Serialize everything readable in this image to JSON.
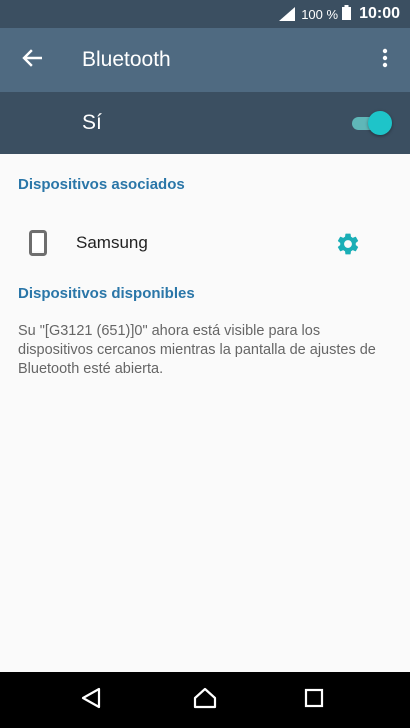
{
  "status_bar": {
    "battery_percent": "100 %",
    "time": "10:00",
    "icons": [
      "signal-icon",
      "battery-icon"
    ]
  },
  "app_bar": {
    "title": "Bluetooth",
    "back_icon": "arrow-back-icon",
    "menu_icon": "more-vert-icon"
  },
  "master_switch": {
    "label": "Sí",
    "state": true
  },
  "sections": {
    "paired_title": "Dispositivos asociados",
    "available_title": "Dispositivos disponibles"
  },
  "paired_devices": [
    {
      "name": "Samsung",
      "icon": "phone-icon",
      "action_icon": "gear-icon"
    }
  ],
  "info_text": "Su \"[G3121 (651)]0\" ahora está visible para los dispositivos cercanos mientras la pantalla de ajustes de Bluetooth esté abierta.",
  "nav_bar": {
    "icons": [
      "back-triangle-icon",
      "home-icon",
      "recents-icon"
    ]
  },
  "colors": {
    "status_bar_bg": "#3b4f61",
    "app_bar_bg": "#4f6a81",
    "accent": "#1ec4c9",
    "section_header": "#2a76a8"
  }
}
